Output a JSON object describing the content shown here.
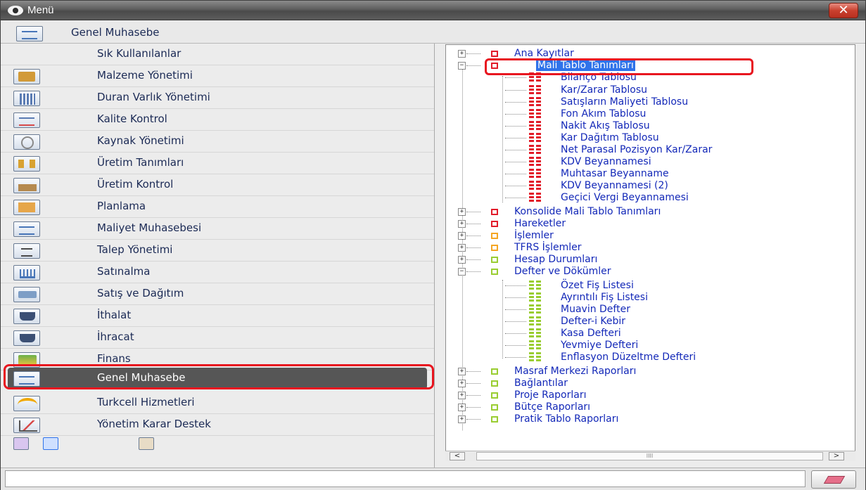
{
  "window": {
    "title": "Menü",
    "close_symbol": "✕"
  },
  "header": {
    "label": "Genel Muhasebe",
    "icon": "form-icon"
  },
  "sidebar": {
    "items": [
      {
        "label": "Sık Kullanılanlar",
        "icon": ""
      },
      {
        "label": "Malzeme Yönetimi",
        "icon": "box-icon"
      },
      {
        "label": "Duran Varlık Yönetimi",
        "icon": "building-icon"
      },
      {
        "label": "Kalite Kontrol",
        "icon": "form-check-icon"
      },
      {
        "label": "Kaynak Yönetimi",
        "icon": "gear-icon"
      },
      {
        "label": "Üretim Tanımları",
        "icon": "flow-icon"
      },
      {
        "label": "Üretim Kontrol",
        "icon": "factory-icon"
      },
      {
        "label": "Planlama",
        "icon": "plan-icon"
      },
      {
        "label": "Maliyet Muhasebesi",
        "icon": "form-icon"
      },
      {
        "label": "Talep Yönetimi",
        "icon": "document-icon"
      },
      {
        "label": "Satınalma",
        "icon": "cart-icon"
      },
      {
        "label": "Satış ve Dağıtım",
        "icon": "truck-icon"
      },
      {
        "label": "İthalat",
        "icon": "ship-icon"
      },
      {
        "label": "İhracat",
        "icon": "ship-icon"
      },
      {
        "label": "Finans",
        "icon": "money-icon"
      },
      {
        "label": "Genel Muhasebe",
        "icon": "form-icon",
        "active": true
      },
      {
        "label": "Turkcell Hizmetleri",
        "icon": "phone-icon"
      },
      {
        "label": "Yönetim Karar Destek",
        "icon": "chart-icon"
      }
    ],
    "bottom_icons": [
      "check-icon",
      "refresh-icon",
      "edit-icon"
    ]
  },
  "tree": {
    "nodes": [
      {
        "label": "Ana Kayıtlar",
        "toggle": "+",
        "color": "red"
      },
      {
        "label": "Mali Tablo Tanımları",
        "toggle": "−",
        "color": "red",
        "selected": true
      },
      {
        "label": "Bilanço Tablosu",
        "child": true
      },
      {
        "label": "Kar/Zarar Tablosu",
        "child": true
      },
      {
        "label": "Satışların Maliyeti Tablosu",
        "child": true
      },
      {
        "label": "Fon Akım Tablosu",
        "child": true
      },
      {
        "label": "Nakit Akış Tablosu",
        "child": true
      },
      {
        "label": "Kar Dağıtım Tablosu",
        "child": true
      },
      {
        "label": "Net Parasal Pozisyon Kar/Zarar",
        "child": true
      },
      {
        "label": "KDV Beyannamesi",
        "child": true
      },
      {
        "label": "Muhtasar Beyanname",
        "child": true
      },
      {
        "label": "KDV Beyannamesi (2)",
        "child": true
      },
      {
        "label": "Geçici Vergi Beyannamesi",
        "child": true
      },
      {
        "label": "Konsolide Mali Tablo Tanımları",
        "toggle": "+",
        "color": "red"
      },
      {
        "label": "Hareketler",
        "toggle": "+",
        "color": "red"
      },
      {
        "label": "İşlemler",
        "toggle": "+",
        "color": "orange"
      },
      {
        "label": "TFRS İşlemler",
        "toggle": "+",
        "color": "orange"
      },
      {
        "label": "Hesap Durumları",
        "toggle": "+",
        "color": "green"
      },
      {
        "label": "Defter ve Dökümler",
        "toggle": "−",
        "color": "green"
      },
      {
        "label": "Özet Fiş Listesi",
        "child": true,
        "color": "green"
      },
      {
        "label": "Ayrıntılı Fiş Listesi",
        "child": true,
        "color": "green"
      },
      {
        "label": "Muavin Defter",
        "child": true,
        "color": "green"
      },
      {
        "label": "Defter-i Kebir",
        "child": true,
        "color": "green"
      },
      {
        "label": "Kasa Defteri",
        "child": true,
        "color": "green"
      },
      {
        "label": "Yevmiye Defteri",
        "child": true,
        "color": "green"
      },
      {
        "label": "Enflasyon Düzeltme Defteri",
        "child": true,
        "color": "green"
      },
      {
        "label": "Masraf Merkezi Raporları",
        "toggle": "+",
        "color": "green"
      },
      {
        "label": "Bağlantılar",
        "toggle": "+",
        "color": "green"
      },
      {
        "label": "Proje Raporları",
        "toggle": "+",
        "color": "green"
      },
      {
        "label": "Bütçe Raporları",
        "toggle": "+",
        "color": "green"
      },
      {
        "label": "Pratik Tablo Raporları",
        "toggle": "+",
        "color": "green"
      }
    ]
  },
  "scrollbar": {
    "left": "<",
    "right": ">",
    "grip": "IIII"
  },
  "status": {
    "value": ""
  },
  "colors": {
    "accent_red": "#e8151f",
    "selection_blue": "#2f73ea",
    "tree_text": "#1328b8"
  }
}
